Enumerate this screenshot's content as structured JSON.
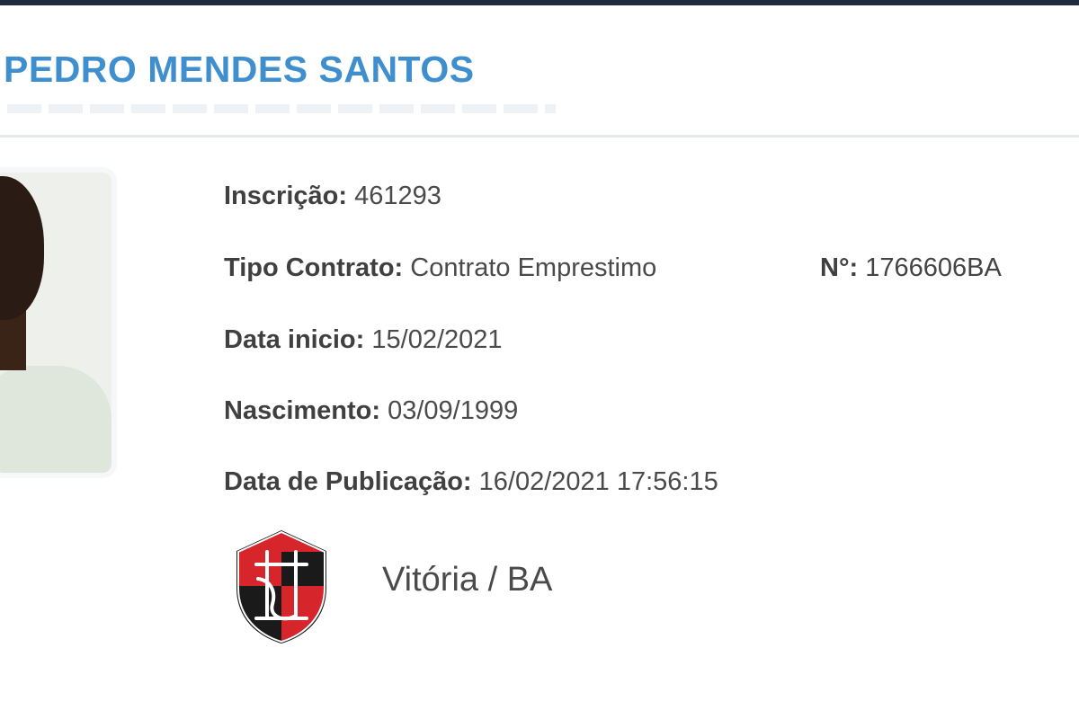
{
  "player": {
    "name": "PEDRO MENDES SANTOS"
  },
  "details": {
    "inscricao": {
      "label": "Inscrição:",
      "value": "461293"
    },
    "tipo_contrato": {
      "label": "Tipo Contrato:",
      "value": "Contrato Emprestimo"
    },
    "numero": {
      "label": "N°:",
      "value": "1766606BA"
    },
    "data_inicio": {
      "label": "Data inicio:",
      "value": "15/02/2021"
    },
    "nascimento": {
      "label": "Nascimento:",
      "value": "03/09/1999"
    },
    "data_publicacao": {
      "label": "Data de Publicação:",
      "value": "16/02/2021 17:56:15"
    }
  },
  "club": {
    "name": "Vitória / BA",
    "crest_icon": "club-crest-icon",
    "colors": {
      "red": "#d7262b",
      "black": "#1a1a1a",
      "border": "#1a1a1a"
    }
  },
  "colors": {
    "name_blue": "#3f8fcf",
    "top_bar": "#1e2a3d",
    "label_text": "#404040"
  }
}
